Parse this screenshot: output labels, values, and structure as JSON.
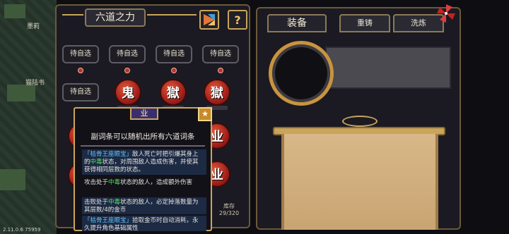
{
  "world": {
    "label_top": "墨莉",
    "label_mid": "猫陆书"
  },
  "version": "2.11.0.6 75959",
  "left_panel": {
    "title": "六道之力",
    "help_label": "?",
    "slots_row1": [
      "待自选",
      "待自选",
      "待自选",
      "待自选"
    ],
    "slot_row2": "待自选",
    "orbs_row2": [
      "鬼",
      "獄",
      "獄"
    ],
    "orbs_side": [
      "业",
      "业"
    ]
  },
  "tooltip": {
    "badge": "业",
    "star": "★",
    "headline": "副词条可以随机出所有六道词条",
    "blocks": [
      {
        "prefix": "「枯骨王座眼宝」",
        "text": "敌人死亡时把引爆其身上的",
        "hl": "中毒",
        "suffix": "状态，对周围敌人造成伤害，并使其获得相同层数的状态。",
        "hl_class": "hl-green",
        "dark": true
      },
      {
        "prefix": "",
        "text": "攻击处于",
        "hl": "中毒",
        "suffix": "状态的敌人，造成额外伤害",
        "hl_class": "hl-green",
        "dark": false
      },
      {
        "prefix": "",
        "text": "击败处于",
        "hl": "中毒",
        "suffix": "状态的敌人，必定掉落数量为其层数/4的金币",
        "hl_class": "hl-green",
        "dark": true
      },
      {
        "prefix": "「枯骨王座眼宝」",
        "text": "拾取金币时自动消耗，永久提升角色基础属性",
        "hl": "",
        "suffix": "",
        "hl_class": "hl-blue",
        "dark": true
      }
    ]
  },
  "storage": {
    "label": "库存",
    "value": "29/320"
  },
  "right_panel": {
    "tabs": [
      "装备",
      "重铸",
      "洗炼"
    ]
  },
  "colors": {
    "gold_border": "#c9a55c",
    "panel_bg": "#1b1a22",
    "orb_red": "#a8231c",
    "highlight_green": "#55e05a",
    "highlight_blue": "#5fc7ff"
  }
}
